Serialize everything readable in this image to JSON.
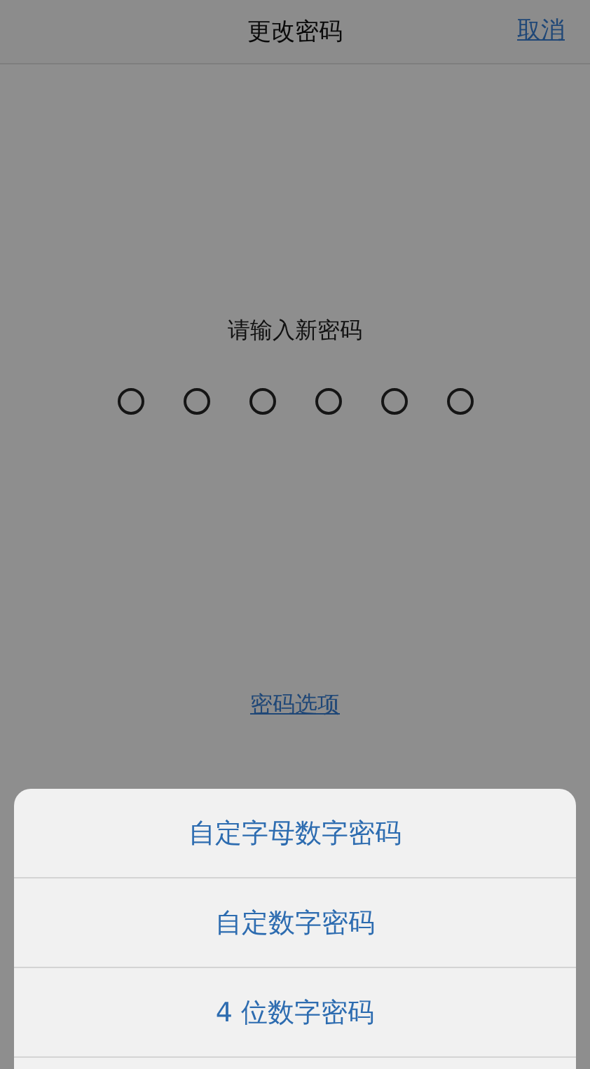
{
  "nav": {
    "title": "更改密码",
    "cancel": "取消"
  },
  "prompt": "请输入新密码",
  "digits": [
    {
      "filled": false
    },
    {
      "filled": false
    },
    {
      "filled": false
    },
    {
      "filled": false
    },
    {
      "filled": false
    },
    {
      "filled": false
    }
  ],
  "options_link": "密码选项",
  "action_sheet": [
    "自定字母数字密码",
    "自定数字密码",
    "4 位数字密码"
  ]
}
